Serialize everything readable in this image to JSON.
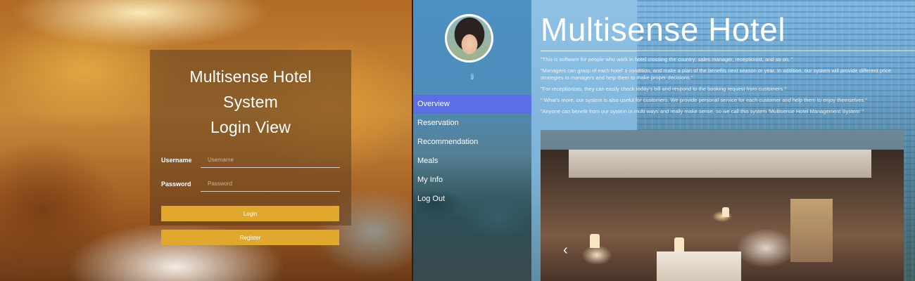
{
  "login": {
    "title_line1": "Multisense Hotel System",
    "title_line2": "Login View",
    "username_label": "Username",
    "username_placeholder": "Username",
    "password_label": "Password",
    "password_placeholder": "Password",
    "login_button": "Login",
    "register_button": "Register"
  },
  "dashboard": {
    "user": {
      "name": "jj"
    },
    "nav": [
      {
        "label": "Overview",
        "active": true
      },
      {
        "label": "Reservation"
      },
      {
        "label": "Recommendation"
      },
      {
        "label": "Meals"
      },
      {
        "label": "My Info"
      },
      {
        "label": "Log Out"
      }
    ],
    "title": "Multisense Hotel",
    "description": [
      "\"This is software for people who work in hotel crossing the country: sales manager, receptionist, and so on. \"",
      "\"Managers can grasp of each hotel' s condition, and make a plan of the benefits next season or year. In addition, our system will provide different price strategies to managers and help them to make proper decisions.\"",
      "\"For receptionists, they can easily check today's bill and respond to the booking request from customers.\"",
      "\" What's more, our system is also useful for customers. We provide personal service for each customer and help them to enjoy themselves.\"",
      "\"Anyone can benefit from our system in multi ways and really make sense, so we call this system 'Multisense Hotel Management System' \""
    ],
    "carousel_prev": "‹"
  },
  "colors": {
    "button": "#e0a92e",
    "nav_active": "#5a6ee6"
  }
}
